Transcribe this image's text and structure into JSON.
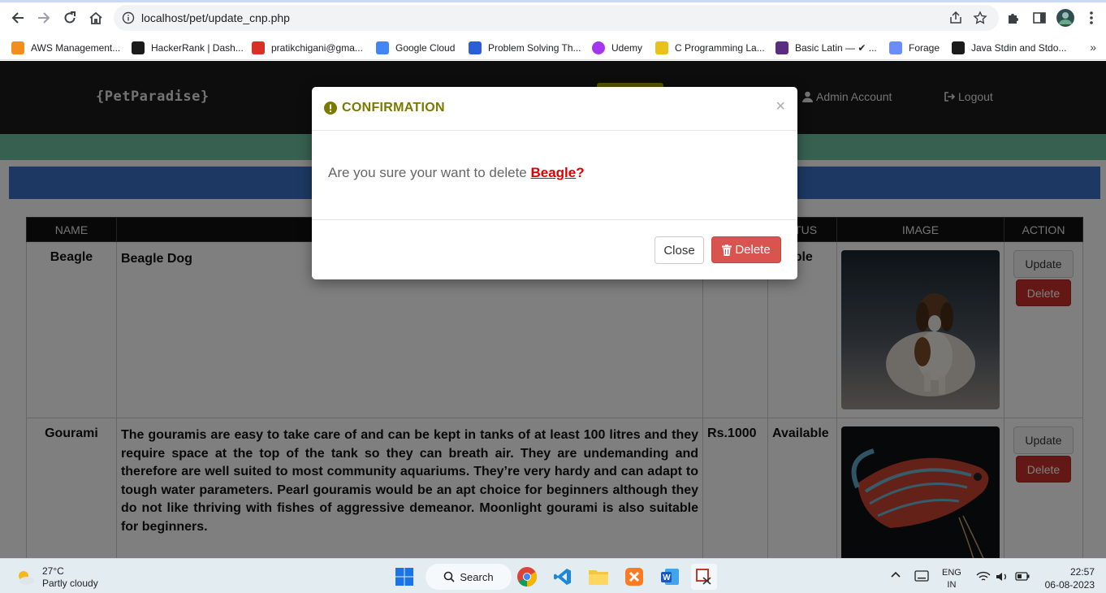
{
  "browser": {
    "url": "localhost/pet/update_cnp.php",
    "bookmarks": [
      {
        "label": "AWS Management...",
        "color": "#f28e1c"
      },
      {
        "label": "HackerRank | Dash...",
        "color": "#1a1a1a"
      },
      {
        "label": "pratikchigani@gma...",
        "color": "#d93025"
      },
      {
        "label": "Google Cloud",
        "color": "#4285f4"
      },
      {
        "label": "Problem Solving Th...",
        "color": "#2b5fd9"
      },
      {
        "label": "Udemy",
        "color": "#a435f0"
      },
      {
        "label": "C Programming La...",
        "color": "#e8c11c"
      },
      {
        "label": "Basic Latin — ✔ ...",
        "color": "#5a2d82"
      },
      {
        "label": "Forage",
        "color": "#6b8cff"
      },
      {
        "label": "Java Stdin and Stdo...",
        "color": "#1a1a1a"
      }
    ],
    "more_label": "»"
  },
  "site": {
    "brand": "{PetParadise}",
    "nav_admin": "Admin Account",
    "nav_logout": "Logout"
  },
  "table": {
    "headers": [
      "NAME",
      "",
      "",
      "ATUS",
      "IMAGE",
      "ACTION"
    ],
    "rows": [
      {
        "name": "Beagle",
        "description": "Beagle Dog",
        "price": "",
        "status": "ailable",
        "update_label": "Update",
        "delete_label": "Delete"
      },
      {
        "name": "Gourami",
        "description": "The gouramis are easy to take care of and can be kept in tanks of at least 100 litres and they require space at the top of the tank so they can breath air. They are undemanding and therefore are well suited to most community aquariums. They’re very hardy and can adapt to tough water parameters. Pearl gouramis would be an apt choice for beginners although they do not like thriving with fishes of aggressive demeanor. Moonlight gourami is also suitable for beginners.",
        "price": "Rs.1000",
        "status": "Available",
        "update_label": "Update",
        "delete_label": "Delete"
      }
    ]
  },
  "modal": {
    "title": "CONFIRMATION",
    "close_symbol": "×",
    "message_prefix": "Are you sure your want to delete ",
    "pet_name": "Beagle",
    "message_suffix": "?",
    "close_label": "Close",
    "delete_label": "Delete"
  },
  "taskbar": {
    "temperature": "27°C",
    "weather": "Partly cloudy",
    "search_label": "Search",
    "lang_top": "ENG",
    "lang_bottom": "IN",
    "time": "22:57",
    "date": "06-08-2023"
  }
}
